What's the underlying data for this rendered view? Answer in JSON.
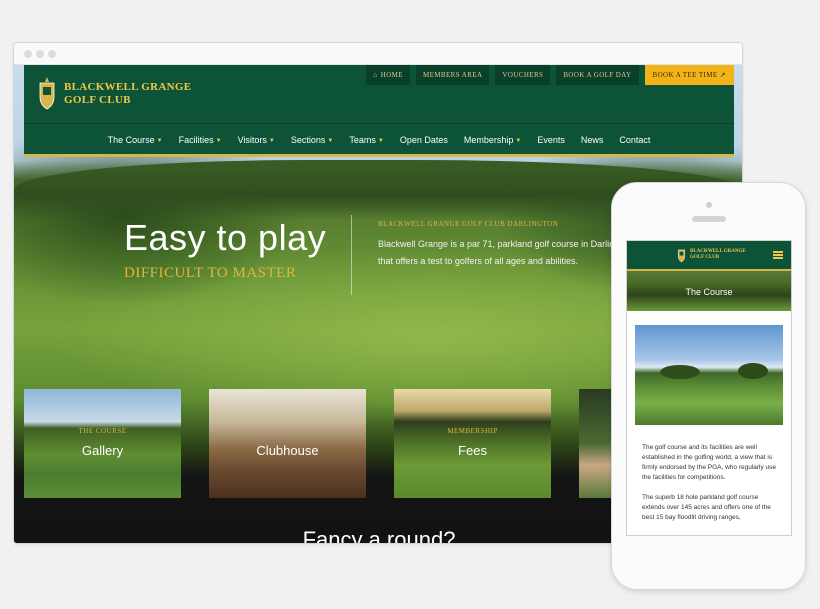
{
  "desktop": {
    "site": {
      "name_line1": "BLACKWELL GRANGE",
      "name_line2": "GOLF CLUB"
    },
    "top_links": [
      {
        "icon": "home-icon",
        "label": "HOME"
      },
      {
        "label": "MEMBERS AREA"
      },
      {
        "label": "VOUCHERS"
      },
      {
        "label": "BOOK A GOLF DAY"
      },
      {
        "label": "BOOK A TEE TIME",
        "icon": "external-link-icon"
      }
    ],
    "nav": [
      {
        "label": "The Course",
        "dropdown": true
      },
      {
        "label": "Facilities",
        "dropdown": true
      },
      {
        "label": "Visitors",
        "dropdown": true
      },
      {
        "label": "Sections",
        "dropdown": true
      },
      {
        "label": "Teams",
        "dropdown": true
      },
      {
        "label": "Open Dates",
        "dropdown": false
      },
      {
        "label": "Membership",
        "dropdown": true
      },
      {
        "label": "Events",
        "dropdown": false
      },
      {
        "label": "News",
        "dropdown": false
      },
      {
        "label": "Contact",
        "dropdown": false
      }
    ],
    "hero": {
      "title": "Easy to play",
      "subtitle": "DIFFICULT TO MASTER",
      "kicker": "BLACKWELL GRANGE GOLF CLUB DARLINGTON",
      "text": "Blackwell Grange is a par 71, parkland golf course in Darlington that offers a test to golfers of all ages and abilities."
    },
    "tiles": [
      {
        "kicker": "THE COURSE",
        "label": "Gallery"
      },
      {
        "kicker": "",
        "label": "Clubhouse"
      },
      {
        "kicker": "MEMBERSHIP",
        "label": "Fees"
      }
    ],
    "fancy_heading": "Fancy a round?"
  },
  "mobile": {
    "site": {
      "name_line1": "BLACKWELL GRANGE",
      "name_line2": "GOLF CLUB"
    },
    "banner_title": "The Course",
    "para1": "The golf course and its facilities are well established in the golfing world, a view that is firmly endorsed by the PGA, who regularly use the facilities for competitions.",
    "para2": "The superb 18 hole parkland golf course extends over 145 acres and offers one of the best 15 bay floodlit driving ranges,"
  },
  "colors": {
    "brand_green": "#0d5337",
    "gold": "#f0c94a",
    "book_button": "#f2b21a"
  }
}
